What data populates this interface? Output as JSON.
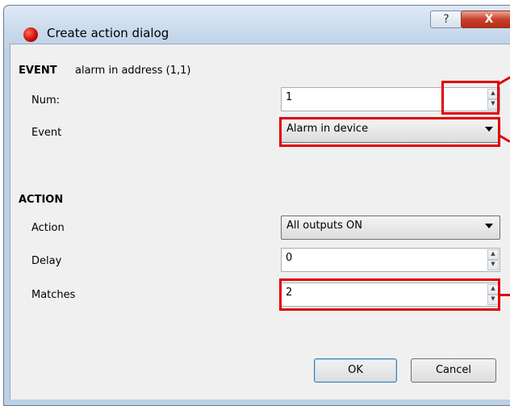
{
  "window": {
    "title": "Create action dialog",
    "help_glyph": "?",
    "close_glyph": "X"
  },
  "event": {
    "heading": "EVENT",
    "description": "alarm  in address (1,1)",
    "num_label": "Num:",
    "num_value": "1",
    "event_label": "Event",
    "event_value": "Alarm in device"
  },
  "action": {
    "heading": "ACTION",
    "action_label": "Action",
    "action_value": "All outputs ON",
    "delay_label": "Delay",
    "delay_value": "0",
    "matches_label": "Matches",
    "matches_value": "2"
  },
  "buttons": {
    "ok": "OK",
    "cancel": "Cancel"
  },
  "colors": {
    "highlight": "#e00000",
    "frame": "#c4d6ea"
  },
  "icons": {
    "app": "red-circle-icon",
    "spin_up": "▲",
    "spin_down": "▼"
  }
}
